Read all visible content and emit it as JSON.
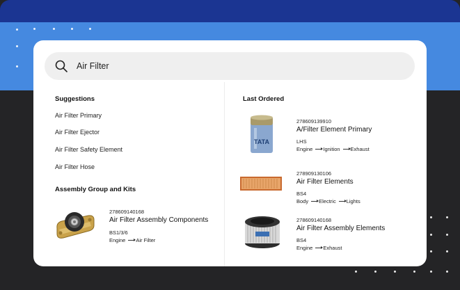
{
  "search": {
    "value": "Air Filter",
    "placeholder": "Search"
  },
  "suggestions": {
    "title": "Suggestions",
    "items": [
      "Air Filter Primary",
      "Air Filter Ejector",
      "Air Filter Safety Element",
      "Air Filter Hose"
    ]
  },
  "assembly": {
    "title": "Assembly Group and Kits",
    "item": {
      "number": "278609140168",
      "name": "Air Filter Assembly Components",
      "spec": "BS1/3/6",
      "path": [
        "Engine",
        "Air Filter"
      ],
      "icon": "bearing-icon"
    }
  },
  "last_ordered": {
    "title": "Last Ordered",
    "items": [
      {
        "number": "278609139910",
        "name": "A/Filter Element Primary",
        "spec": "LHS",
        "path": [
          "Engine",
          "Ignition",
          "Exhaust"
        ],
        "icon": "cylinder-filter-icon"
      },
      {
        "number": "278909130106",
        "name": "Air Filter Elements",
        "spec": "BS4",
        "path": [
          "Body",
          "Electric",
          "Lights"
        ],
        "icon": "panel-filter-icon"
      },
      {
        "number": "278609140168",
        "name": "Air Filter Assembly Elements",
        "spec": "BS4",
        "path": [
          "Engine",
          "Exhaust"
        ],
        "icon": "oval-filter-icon"
      }
    ]
  },
  "colors": {
    "dark_band": "#1b3592",
    "blue_band": "#4589e0",
    "background": "#242426",
    "search_bg": "#efefef"
  }
}
